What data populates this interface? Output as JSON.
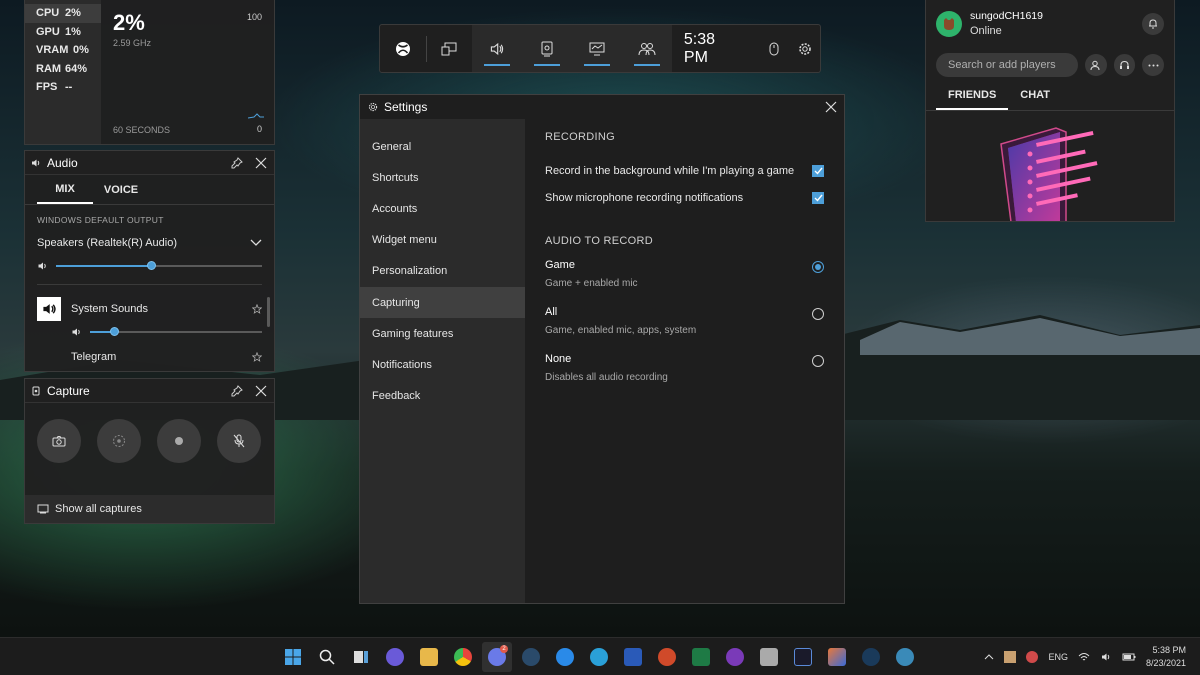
{
  "performance": {
    "stats": [
      {
        "key": "CPU",
        "value": "2%"
      },
      {
        "key": "GPU",
        "value": "1%"
      },
      {
        "key": "VRAM",
        "value": "0%"
      },
      {
        "key": "RAM",
        "value": "64%"
      },
      {
        "key": "FPS",
        "value": "--"
      }
    ],
    "big_value": "2%",
    "clock_speed": "2.59 GHz",
    "max": "100",
    "min": "0",
    "window": "60 SECONDS"
  },
  "audio": {
    "title": "Audio",
    "tabs": [
      "MIX",
      "VOICE"
    ],
    "output_label": "WINDOWS DEFAULT OUTPUT",
    "device": "Speakers (Realtek(R) Audio)",
    "master_level": 0.46,
    "apps": [
      {
        "name": "System Sounds",
        "level": 0.14
      },
      {
        "name": "Telegram"
      }
    ]
  },
  "capture": {
    "title": "Capture",
    "show_all": "Show all captures"
  },
  "topbar": {
    "time": "5:38 PM"
  },
  "settings": {
    "title": "Settings",
    "nav": [
      "General",
      "Shortcuts",
      "Accounts",
      "Widget menu",
      "Personalization",
      "Capturing",
      "Gaming features",
      "Notifications",
      "Feedback"
    ],
    "active_nav": "Capturing",
    "recording_heading": "RECORDING",
    "checkboxes": [
      {
        "label": "Record in the background while I'm playing a game",
        "checked": true
      },
      {
        "label": "Show microphone recording notifications",
        "checked": true
      }
    ],
    "audio_heading": "AUDIO TO RECORD",
    "radios": [
      {
        "title": "Game",
        "sub": "Game + enabled mic",
        "selected": true
      },
      {
        "title": "All",
        "sub": "Game, enabled mic, apps, system",
        "selected": false
      },
      {
        "title": "None",
        "sub": "Disables all audio recording",
        "selected": false
      }
    ]
  },
  "social": {
    "username": "sungodCH1619",
    "status": "Online",
    "search_placeholder": "Search or add players",
    "tabs": [
      "FRIENDS",
      "CHAT"
    ]
  },
  "taskbar": {
    "language": "ENG",
    "time": "5:38 PM",
    "date": "8/23/2021",
    "discord_badge": "2"
  },
  "colors": {
    "accent": "#4d9fd9"
  }
}
